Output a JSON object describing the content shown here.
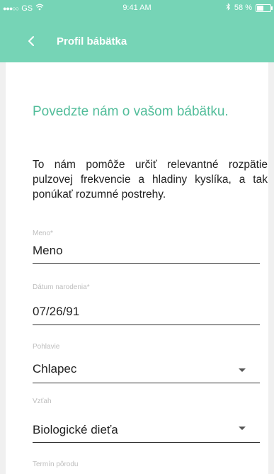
{
  "status_bar": {
    "signal": "●●●○○",
    "carrier": "GS",
    "time": "9:41 AM",
    "battery_percent_text": "58 %",
    "battery_level": 0.58
  },
  "nav": {
    "title": "Profil bábätka"
  },
  "form": {
    "heading": "Povedzte nám o vašom bábätku.",
    "intro": "To nám pomôže určiť relevantné rozpätie pulzovej frekvencie a hladiny kyslíka, a tak ponúkať rozumné postrehy.",
    "name": {
      "label": "Meno*",
      "placeholder": "Meno"
    },
    "birthdate": {
      "label": "Dátum narodenia*",
      "value": "07/26/91"
    },
    "gender": {
      "label": "Pohlavie",
      "value": "Chlapec"
    },
    "relation": {
      "label": "Vzťah",
      "value": "Biologické dieťa"
    },
    "due_date": {
      "label": "Termín pôrodu"
    }
  },
  "colors": {
    "header_bg": "#76d4b6",
    "accent": "#52bd9a"
  }
}
